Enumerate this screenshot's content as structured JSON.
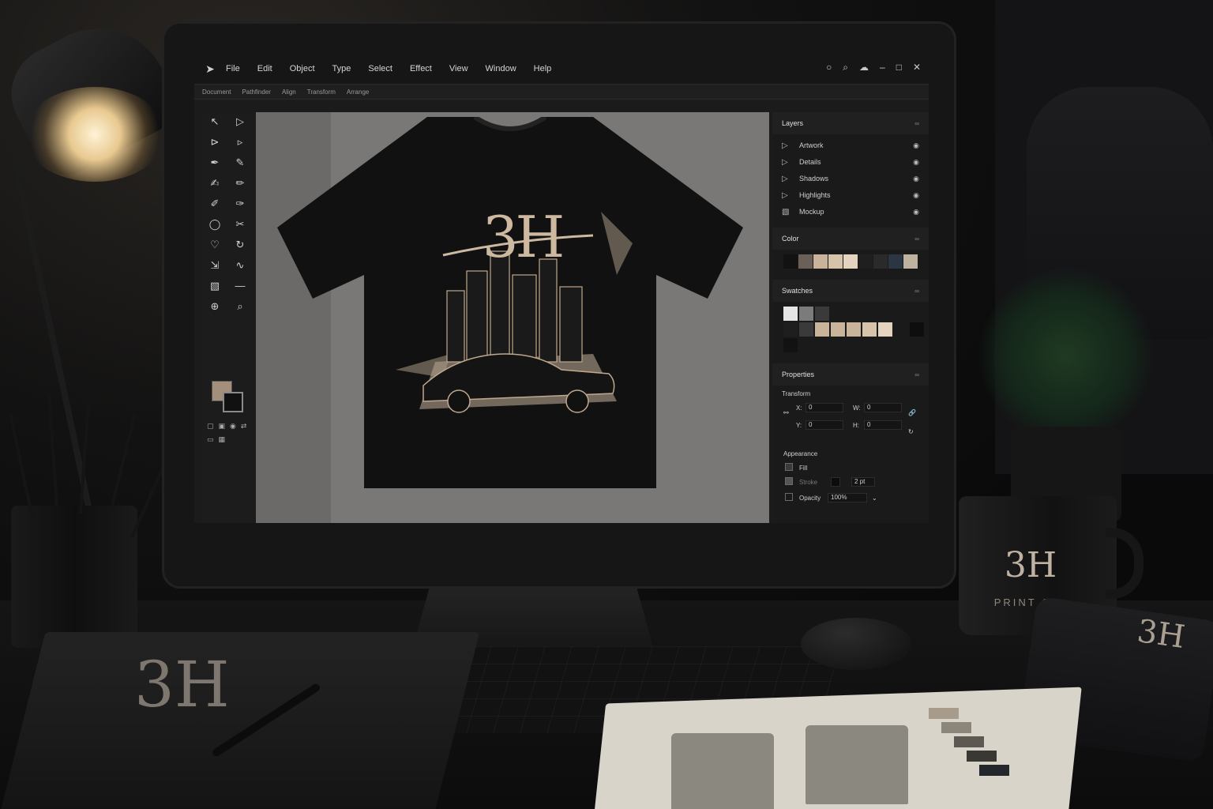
{
  "menu": {
    "items": [
      "File",
      "Edit",
      "Object",
      "Type",
      "Select",
      "Effect",
      "View",
      "Window",
      "Help"
    ]
  },
  "options_bar": {
    "items": [
      "Document",
      "Pathfinder",
      "Align",
      "Transform",
      "Arrange"
    ]
  },
  "design": {
    "logo_text": "3H"
  },
  "panels": {
    "layers": {
      "title": "Layers",
      "items": [
        "Artwork",
        "Details",
        "Shadows",
        "Highlights",
        "Mockup"
      ]
    },
    "color": {
      "title": "Color",
      "chips": [
        "#121212",
        "#6b6058",
        "#c9b39b",
        "#d7c2aa",
        "#e3d3bf",
        "#1f1f1f",
        "#2a2a2a",
        "#2c3544",
        "#bfb29f"
      ]
    },
    "swatches": {
      "title": "Swatches",
      "row1": [
        "#e6e6e6",
        "#7b7b7b",
        "#3a3a3a",
        "#1a1a1a",
        "#1a1a1a",
        "#1a1a1a",
        "#1a1a1a",
        "#1a1a1a",
        "#1a1a1a"
      ],
      "row2": [
        "#1e1e1e",
        "#3a3a3a",
        "#c9b39b",
        "#c9b39b",
        "#c9b39b",
        "#d7c2aa",
        "#e3d3bf",
        "#1a1a1a",
        "#0e0e0e"
      ],
      "row3": [
        "#121212",
        "#1a1a1a",
        "#1a1a1a",
        "#1a1a1a",
        "#1a1a1a",
        "#1a1a1a",
        "#1a1a1a",
        "#1a1a1a",
        "#1a1a1a"
      ]
    },
    "properties": {
      "title": "Properties",
      "transform_label": "Transform",
      "x_label": "X:",
      "x_value": "0",
      "y_label": "Y:",
      "y_value": "0",
      "w_label": "W:",
      "w_value": "0",
      "h_label": "H:",
      "h_value": "0",
      "appearance_label": "Appearance",
      "fill_label": "Fill",
      "stroke_label": "Stroke",
      "stroke_value": "2 pt",
      "opacity_label": "Opacity",
      "opacity_value": "100%"
    }
  },
  "desk": {
    "mug_logo": "3H",
    "mug_text": "PRINT CO.",
    "notebook_logo": "3H",
    "folded_logo": "3H"
  },
  "colors": {
    "accent_tan": "#cdb8a0",
    "ui_bg": "#1b1b1c",
    "canvas_gray": "#7a7876"
  }
}
